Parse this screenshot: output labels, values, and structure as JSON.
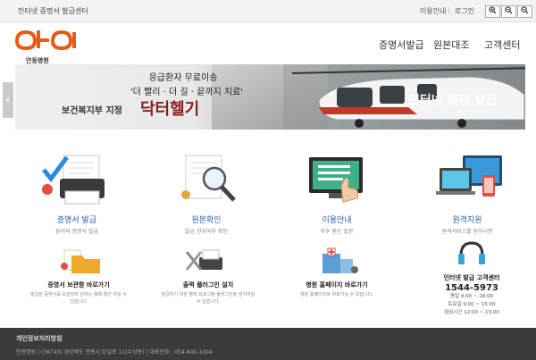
{
  "topbar": {
    "site_title": "인터넷 증명서 발급센터",
    "guide_link": "이용안내",
    "login_link": "로그인",
    "zoom_in": "⊕",
    "zoom_reset": "⊖",
    "zoom_out": "⊖"
  },
  "header": {
    "logo_text": "안동병원",
    "nav": [
      "증명서발급",
      "원본대조",
      "고객센터"
    ]
  },
  "banner": {
    "line1": "응급환자 무료이송",
    "line2": "'더 빨리 · 더 길 · 끝까지 치료'",
    "line3_prefix": "보건복지부 지정",
    "line3_main": "닥터헬기",
    "cert_title": "인터넷 증명 발급"
  },
  "services": [
    {
      "label": "증명서 발급",
      "sub": "원리와 증명서 발급",
      "icon": "printer-certificate-icon"
    },
    {
      "label": "원본확인",
      "sub": "발급 진위여부 확인",
      "icon": "magnifier-document-icon"
    },
    {
      "label": "이용안내",
      "sub": "자주 묻는 질문",
      "icon": "monitor-hand-icon"
    },
    {
      "label": "원격지원",
      "sub": "원격서비스를 원하시면",
      "icon": "devices-icon"
    }
  ],
  "links": [
    {
      "label": "증명서 보관함 바로가기",
      "sub": "발급한 증명서를 보관하며 원하는 때에 확인 하실 수 있습니다.",
      "icon": "folder-icon"
    },
    {
      "label": "출력 플러그인 설치",
      "sub": "발급하기 위한 출력 프로그램 플러그인을 설치하실 수 있습니다.",
      "icon": "tools-icon"
    },
    {
      "label": "병원 홈페이지 바로가기",
      "sub": "병원 홈페이지로 바로가실 수 있습니다.",
      "icon": "hospital-icon"
    }
  ],
  "callcenter": {
    "label": "인터넷 발급 고객센터",
    "phone": "1544-5973",
    "hours_weekday": "평일 9:00 ~ 18:00",
    "hours_weekend": "토요일 9:00 ~ 15:00",
    "hours_lunch": "점심시간 12:00 ~ 13:00"
  },
  "footer": {
    "privacy": "개인정보처리방침",
    "address": "안동병원 | (36743) 경상북도 안동시 앙실로 11(수상동) | 대표전화 : 054-840-1004"
  },
  "colors": {
    "accent_blue": "#2a64a8",
    "logo_orange": "#e8591a",
    "footer_bg": "#3b3b3b"
  }
}
